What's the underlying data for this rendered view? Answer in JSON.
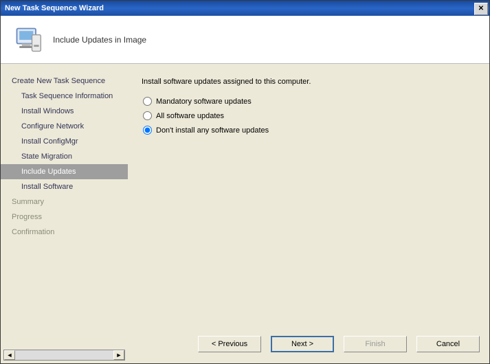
{
  "window": {
    "title": "New Task Sequence Wizard"
  },
  "header": {
    "heading": "Include Updates in Image"
  },
  "sidebar": {
    "items": [
      {
        "label": "Create New Task Sequence",
        "sub": false,
        "muted": false,
        "selected": false
      },
      {
        "label": "Task Sequence Information",
        "sub": true,
        "muted": false,
        "selected": false
      },
      {
        "label": "Install Windows",
        "sub": true,
        "muted": false,
        "selected": false
      },
      {
        "label": "Configure Network",
        "sub": true,
        "muted": false,
        "selected": false
      },
      {
        "label": "Install ConfigMgr",
        "sub": true,
        "muted": false,
        "selected": false
      },
      {
        "label": "State Migration",
        "sub": true,
        "muted": false,
        "selected": false
      },
      {
        "label": "Include Updates",
        "sub": true,
        "muted": false,
        "selected": true
      },
      {
        "label": "Install Software",
        "sub": true,
        "muted": false,
        "selected": false
      },
      {
        "label": "Summary",
        "sub": false,
        "muted": true,
        "selected": false
      },
      {
        "label": "Progress",
        "sub": false,
        "muted": true,
        "selected": false
      },
      {
        "label": "Confirmation",
        "sub": false,
        "muted": true,
        "selected": false
      }
    ]
  },
  "content": {
    "prompt": "Install software updates assigned to this computer.",
    "options": [
      {
        "label": "Mandatory software updates",
        "checked": false
      },
      {
        "label": "All software updates",
        "checked": false
      },
      {
        "label": "Don't install any software updates",
        "checked": true
      }
    ]
  },
  "buttons": {
    "previous": "< Previous",
    "next": "Next >",
    "finish": "Finish",
    "cancel": "Cancel"
  }
}
